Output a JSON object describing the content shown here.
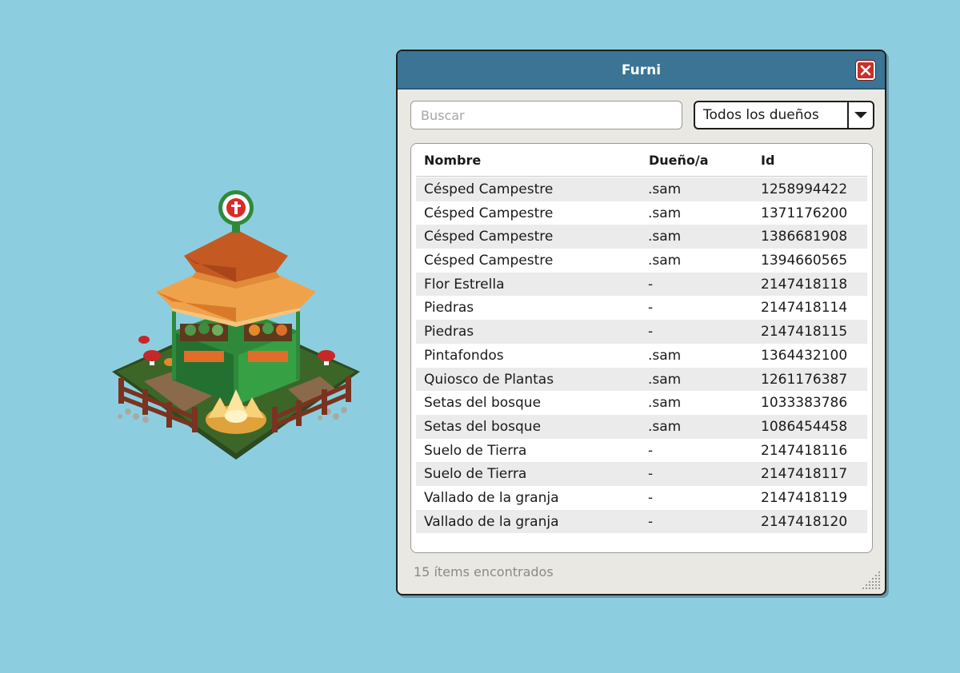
{
  "window": {
    "title": "Furni",
    "close_icon": "close-icon"
  },
  "search": {
    "placeholder": "Buscar",
    "value": ""
  },
  "owner_filter": {
    "selected": "Todos los dueños",
    "icon": "chevron-down-icon"
  },
  "table": {
    "columns": [
      "Nombre",
      "Dueño/a",
      "Id"
    ],
    "rows": [
      [
        "Césped Campestre",
        ".sam",
        "1258994422"
      ],
      [
        "Césped Campestre",
        ".sam",
        "1371176200"
      ],
      [
        "Césped Campestre",
        ".sam",
        "1386681908"
      ],
      [
        "Césped Campestre",
        ".sam",
        "1394660565"
      ],
      [
        "Flor Estrella",
        "-",
        "2147418118"
      ],
      [
        "Piedras",
        "-",
        "2147418114"
      ],
      [
        "Piedras",
        "-",
        "2147418115"
      ],
      [
        "Pintafondos",
        ".sam",
        "1364432100"
      ],
      [
        "Quiosco de Plantas",
        ".sam",
        "1261176387"
      ],
      [
        "Setas del bosque",
        ".sam",
        "1033383786"
      ],
      [
        "Setas del bosque",
        ".sam",
        "1086454458"
      ],
      [
        "Suelo de Tierra",
        "-",
        "2147418116"
      ],
      [
        "Suelo de Tierra",
        "-",
        "2147418117"
      ],
      [
        "Vallado de la granja",
        "-",
        "2147418119"
      ],
      [
        "Vallado de la granja",
        "-",
        "2147418120"
      ]
    ]
  },
  "status": {
    "text": "15 ítems encontrados"
  },
  "colors": {
    "background": "#8ccedf",
    "titlebar": "#3b7494",
    "close": "#c8302a"
  }
}
